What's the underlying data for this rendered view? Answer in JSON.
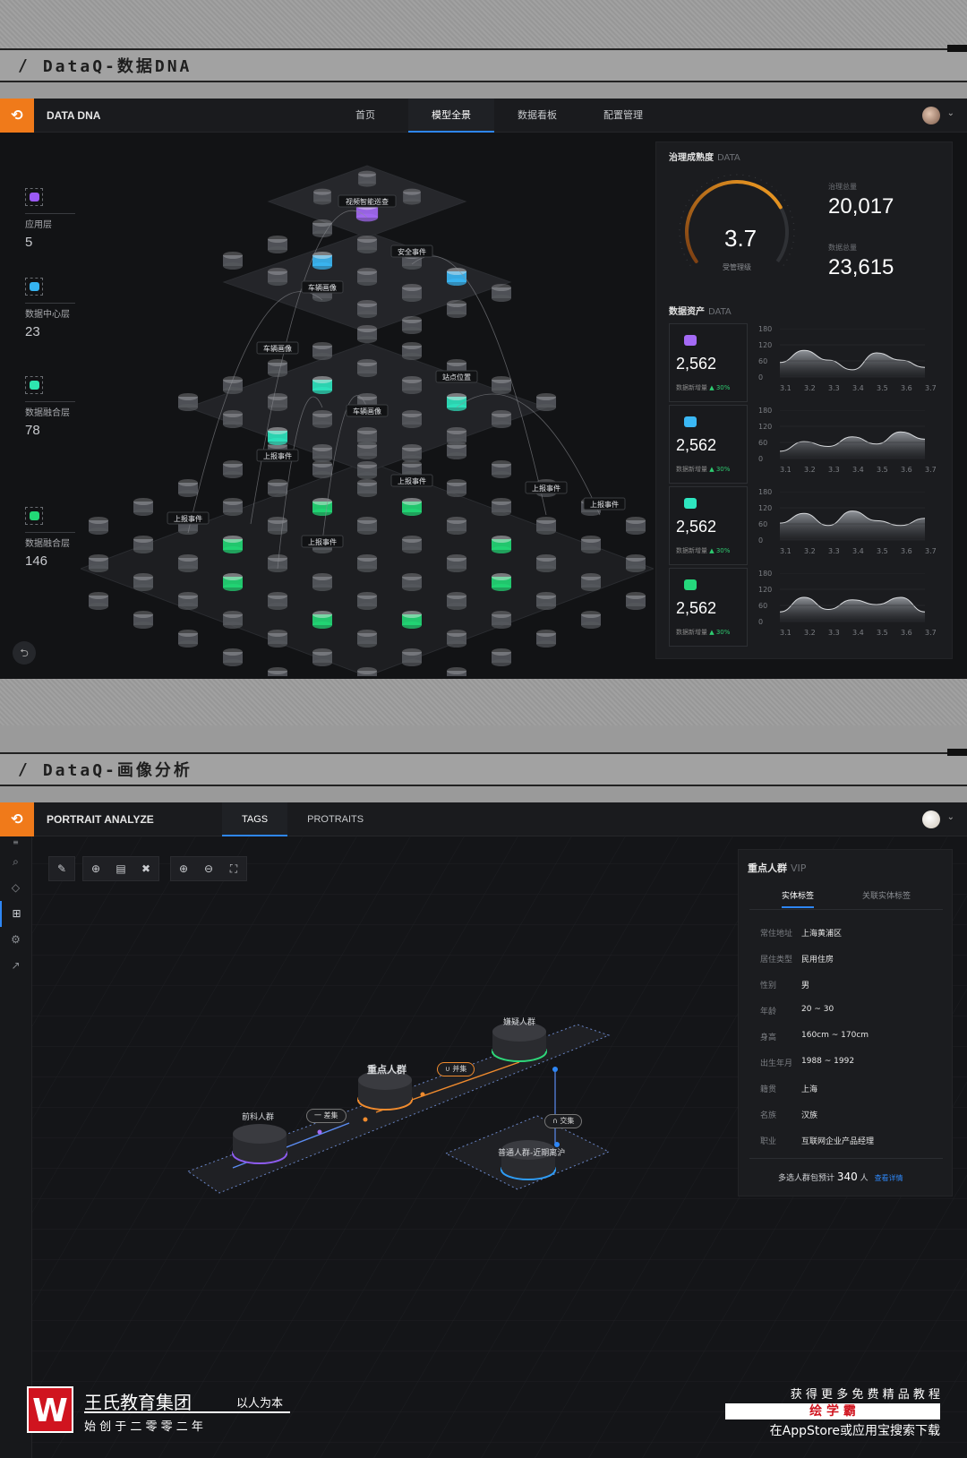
{
  "sections": [
    {
      "title": "DataQ-数据DNA"
    },
    {
      "title": "DataQ-画像分析"
    }
  ],
  "dna": {
    "brand": "DATA DNA",
    "nav": [
      "首页",
      "模型全景",
      "数据看板",
      "配置管理"
    ],
    "active_nav": "模型全景",
    "layers": [
      {
        "name": "应用层",
        "count": "5",
        "color": "#9b59f5"
      },
      {
        "name": "数据中心层",
        "count": "23",
        "color": "#35b4f2"
      },
      {
        "name": "数据融合层",
        "count": "78",
        "color": "#2ee6b0"
      },
      {
        "name": "数据融合层",
        "count": "146",
        "color": "#22d876"
      }
    ],
    "model_labels": [
      "视频智能巡查",
      "安全事件",
      "车辆画像",
      "车辆画像",
      "站点位置",
      "车辆画像",
      "上报事件",
      "上报事件",
      "上报事件",
      "上报事件",
      "上报事件",
      "上报事件"
    ],
    "governance": {
      "title": "治理成熟度",
      "subtitle": "DATA",
      "gauge_value": "3.7",
      "gauge_fraction": 0.74,
      "gauge_label": "受管理级",
      "stat1_label": "治理总量",
      "stat1_value": "20,017",
      "stat2_label": "数据总量",
      "stat2_value": "23,615"
    },
    "assets": {
      "title": "数据资产",
      "subtitle": "DATA",
      "y_ticks": [
        "180",
        "120",
        "60",
        "0"
      ],
      "x_ticks": [
        "3.1",
        "3.2",
        "3.3",
        "3.4",
        "3.5",
        "3.6",
        "3.7"
      ],
      "cards": [
        {
          "value": "2,562",
          "label": "数据新增量",
          "trend": "▲ 30%",
          "color": "#a46af5"
        },
        {
          "value": "2,562",
          "label": "数据新增量",
          "trend": "▲ 30%",
          "color": "#3bb8f5"
        },
        {
          "value": "2,562",
          "label": "数据新增量",
          "trend": "▲ 30%",
          "color": "#2ee6c0"
        },
        {
          "value": "2,562",
          "label": "数据新增量",
          "trend": "▲ 30%",
          "color": "#25d87c"
        }
      ]
    }
  },
  "portrait": {
    "brand": "PORTRAIT ANALYZE",
    "tabs": [
      "TAGS",
      "PROTRAITS"
    ],
    "active_tab": "TAGS",
    "nodes": {
      "n1": "前科人群",
      "n2": "重点人群",
      "n3": "嫌疑人群",
      "n4": "普通人群-近期离沪"
    },
    "ops": {
      "diff": "一 差集",
      "union": "∪ 并集",
      "inter": "∩ 交集"
    },
    "vip": {
      "title": "重点人群",
      "badge": "VIP",
      "tabs": [
        "实体标签",
        "关联实体标签"
      ],
      "rows": [
        {
          "k": "常住地址",
          "v": "上海黄浦区"
        },
        {
          "k": "居住类型",
          "v": "民用住房"
        },
        {
          "k": "性别",
          "v": "男"
        },
        {
          "k": "年龄",
          "v": "20 ~ 30"
        },
        {
          "k": "身高",
          "v": "160cm ~ 170cm"
        },
        {
          "k": "出生年月",
          "v": "1988 ~ 1992"
        },
        {
          "k": "籍贯",
          "v": "上海"
        },
        {
          "k": "名族",
          "v": "汉族"
        },
        {
          "k": "职业",
          "v": "互联网企业产品经理"
        }
      ],
      "footer_prefix": "多选人群包预计",
      "footer_count": "340",
      "footer_unit": "人",
      "footer_link": "查看详情"
    }
  },
  "watermark": {
    "org": "王氏教育集团",
    "slogan": "以人为本",
    "since": "始 创 于 二 零 零 二 年",
    "promo1": "获 得 更 多 免 费 精 品 教 程",
    "promo2": "绘 学 霸",
    "promo3": "在AppStore或应用宝搜索下载"
  }
}
